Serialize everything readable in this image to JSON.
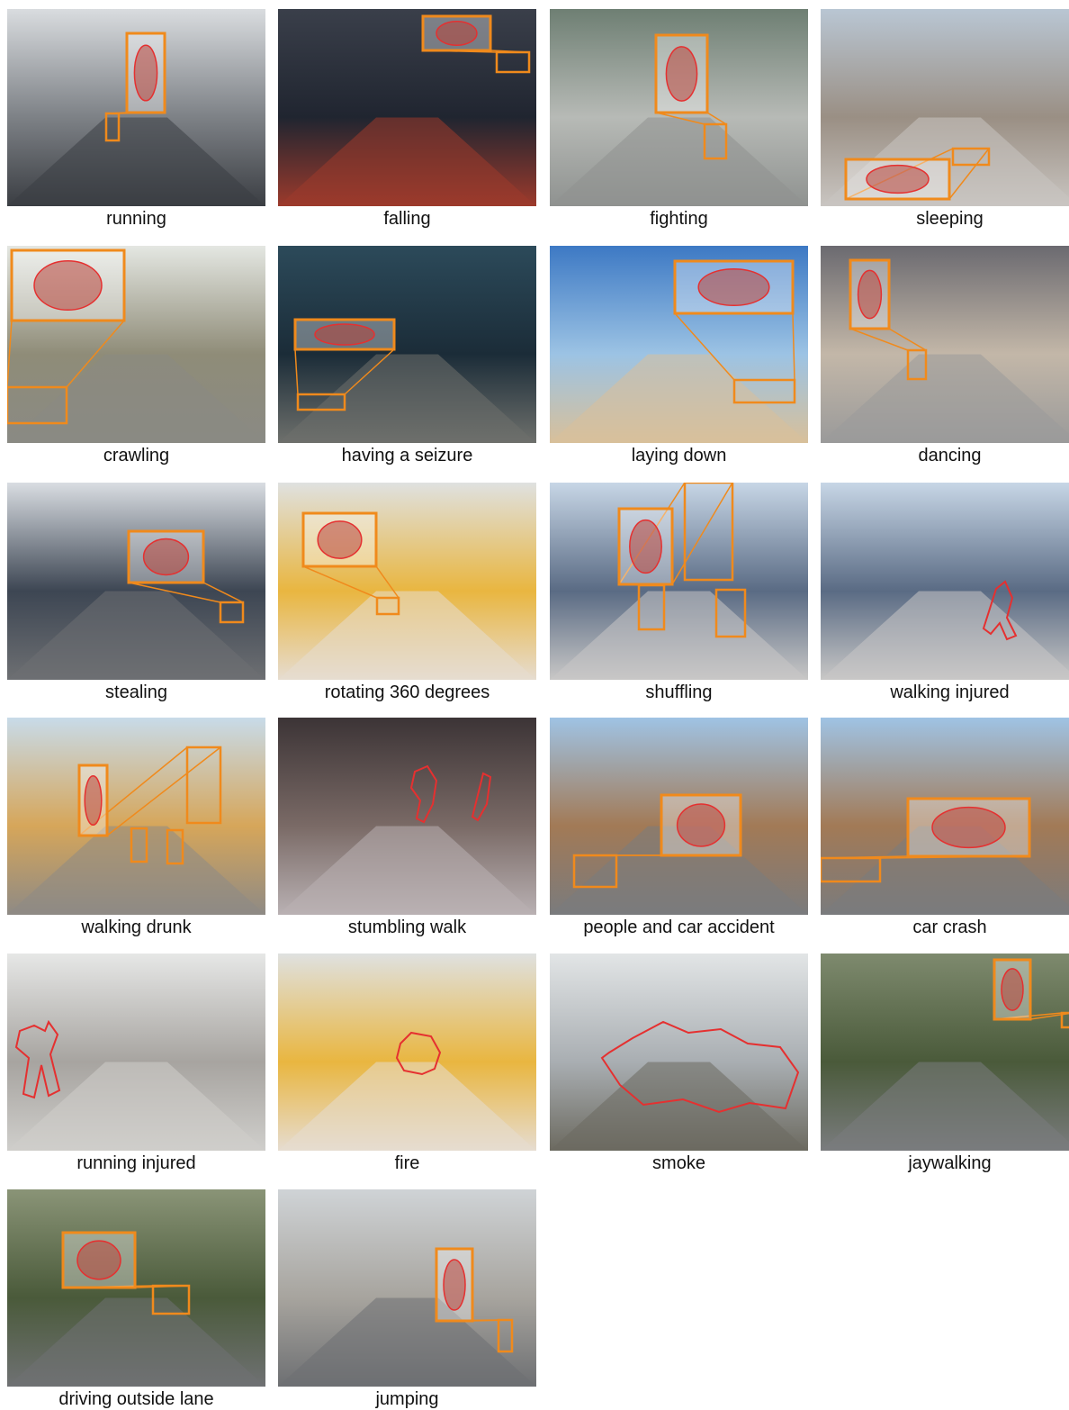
{
  "figure": {
    "highlight_color": "#f08a1c",
    "outline_color": "#e53030",
    "panels": [
      {
        "caption": "running"
      },
      {
        "caption": "falling"
      },
      {
        "caption": "fighting"
      },
      {
        "caption": "sleeping"
      },
      {
        "caption": "crawling"
      },
      {
        "caption": "having a seizure"
      },
      {
        "caption": "laying down"
      },
      {
        "caption": "dancing"
      },
      {
        "caption": "stealing"
      },
      {
        "caption": "rotating 360 degrees"
      },
      {
        "caption": "shuffling"
      },
      {
        "caption": "walking injured"
      },
      {
        "caption": "walking drunk"
      },
      {
        "caption": "stumbling walk"
      },
      {
        "caption": "people and car accident"
      },
      {
        "caption": "car crash"
      },
      {
        "caption": "running injured"
      },
      {
        "caption": "fire"
      },
      {
        "caption": "smoke"
      },
      {
        "caption": "jaywalking"
      },
      {
        "caption": "driving outside lane"
      },
      {
        "caption": "jumping"
      }
    ]
  }
}
